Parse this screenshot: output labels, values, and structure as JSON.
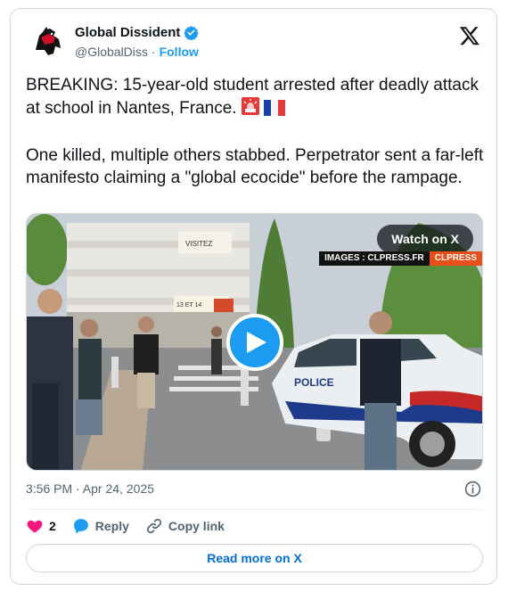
{
  "author": {
    "display_name": "Global Dissident",
    "handle": "@GlobalDiss",
    "separator": "·",
    "follow_label": "Follow",
    "verified": true,
    "avatar_icon": "horse-logo-icon"
  },
  "tweet": {
    "paragraph1": "BREAKING: 15-year-old student arrested after deadly attack at school in Nantes, France.",
    "paragraph2": "One killed, multiple others stabbed. Perpetrator sent a far-left manifesto claiming a \"global ecocide\" before the rampage.",
    "emojis": [
      "rotating-light-icon",
      "france-flag-icon"
    ]
  },
  "media": {
    "watch_label": "Watch on X",
    "credit_left": "IMAGES : CLPRESS.FR",
    "credit_right": "CLPRESS",
    "police_text": "POLICE",
    "shop_sign": "VISITEZ",
    "banner_text": "13 ET 14"
  },
  "meta": {
    "timestamp": "3:56 PM · Apr 24, 2025"
  },
  "actions": {
    "like_count": "2",
    "reply_label": "Reply",
    "copy_label": "Copy link"
  },
  "read_more_label": "Read more on X",
  "colors": {
    "accent": "#1d9bf0",
    "like": "#f91880",
    "link": "#006fd6",
    "muted": "#536471"
  }
}
